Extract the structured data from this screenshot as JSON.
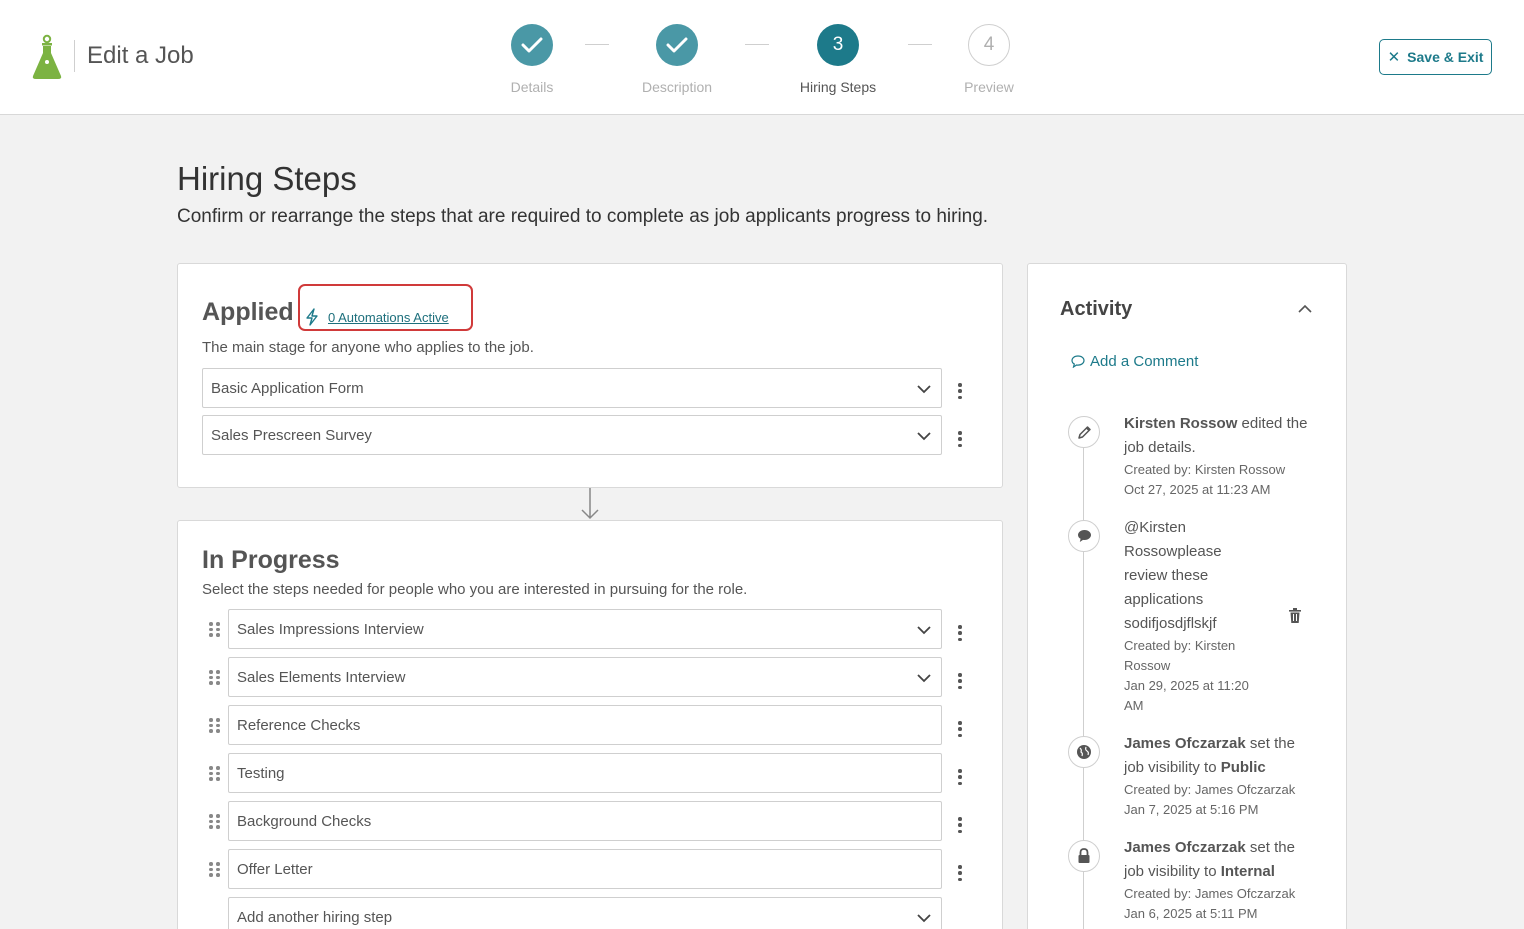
{
  "header": {
    "title": "Edit a Job",
    "save_exit_label": "Save & Exit",
    "steps": [
      {
        "number": "1",
        "label": "Details",
        "state": "done"
      },
      {
        "number": "2",
        "label": "Description",
        "state": "done"
      },
      {
        "number": "3",
        "label": "Hiring Steps",
        "state": "current"
      },
      {
        "number": "4",
        "label": "Preview",
        "state": "todo"
      }
    ]
  },
  "page": {
    "title": "Hiring Steps",
    "subtitle": "Confirm or rearrange the steps that are required to complete as job applicants progress to hiring."
  },
  "applied": {
    "title": "Applied",
    "automations_link": "0 Automations Active",
    "description": "The main stage for anyone who applies to the job.",
    "steps": [
      {
        "label": "Basic Application Form",
        "has_dropdown": true
      },
      {
        "label": "Sales Prescreen Survey",
        "has_dropdown": true
      }
    ]
  },
  "in_progress": {
    "title": "In Progress",
    "description": "Select the steps needed for people who you are interested in pursuing for the role.",
    "steps": [
      {
        "label": "Sales Impressions Interview",
        "has_dropdown": true
      },
      {
        "label": "Sales Elements Interview",
        "has_dropdown": true
      },
      {
        "label": "Reference Checks",
        "has_dropdown": false
      },
      {
        "label": "Testing",
        "has_dropdown": false
      },
      {
        "label": "Background Checks",
        "has_dropdown": false
      },
      {
        "label": "Offer Letter",
        "has_dropdown": false
      }
    ],
    "add_step_placeholder": "Add another hiring step"
  },
  "activity": {
    "title": "Activity",
    "add_comment_label": "Add a Comment",
    "items": [
      {
        "icon": "pencil-icon",
        "actor": "Kirsten Rossow",
        "line_1": "Kirsten Rossow",
        "line_1_rest": " edited the",
        "line_2": "job details.",
        "created_by": "Created by: Kirsten Rossow",
        "date": "Oct 27, 2025 at 11:23 AM"
      },
      {
        "icon": "comment-icon",
        "comment_lines": [
          "@Kirsten",
          "Rossowplease",
          "review these",
          "applications",
          "sodifjosdjflskjf"
        ],
        "created_by_lines": [
          "Created by: Kirsten",
          "Rossow"
        ],
        "date_lines": [
          "Jan 29, 2025 at 11:20",
          "AM"
        ]
      },
      {
        "icon": "globe-icon",
        "actor": "James Ofczarzak",
        "rest": " set the",
        "line_2": "job visibility to ",
        "value": "Public",
        "created_by": "Created by: James Ofczarzak",
        "date": "Jan 7, 2025 at 5:16 PM"
      },
      {
        "icon": "lock-icon",
        "actor": "James Ofczarzak",
        "rest": " set the",
        "line_2": "job visibility to ",
        "value": "Internal",
        "created_by": "Created by: James Ofczarzak",
        "date": "Jan 6, 2025 at 5:11 PM"
      }
    ]
  },
  "colors": {
    "accent": "#1d7a8a",
    "step_done": "#4a98a6",
    "highlight_border": "#d03a3a",
    "logo_green": "#7cb342"
  }
}
